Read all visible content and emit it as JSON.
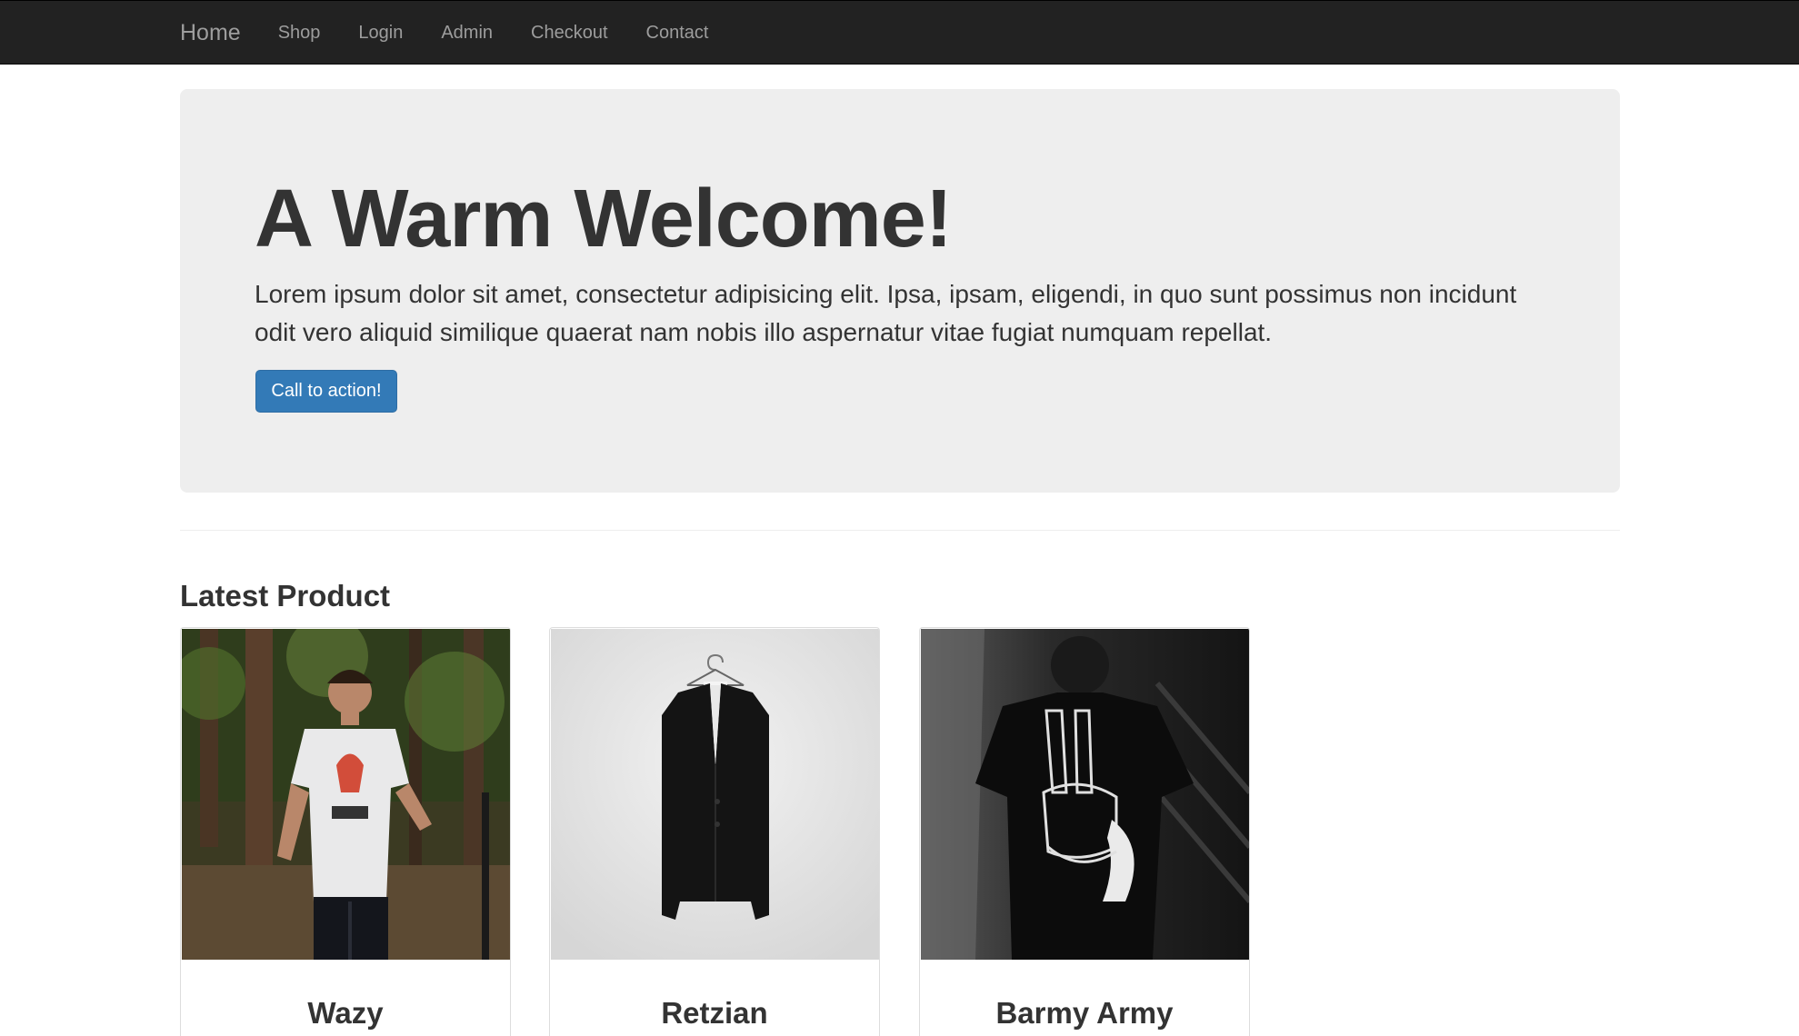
{
  "navbar": {
    "brand": "Home",
    "links": [
      "Shop",
      "Login",
      "Admin",
      "Checkout",
      "Contact"
    ]
  },
  "hero": {
    "title": "A Warm Welcome!",
    "text": "Lorem ipsum dolor sit amet, consectetur adipisicing elit. Ipsa, ipsam, eligendi, in quo sunt possimus non incidunt odit vero aliquid similique quaerat nam nobis illo aspernatur vitae fugiat numquam repellat.",
    "cta_label": "Call to action!"
  },
  "latest": {
    "heading": "Latest Product",
    "products": [
      {
        "name": "Wazy"
      },
      {
        "name": "Retzian"
      },
      {
        "name": "Barmy Army"
      }
    ]
  },
  "colors": {
    "navbar_bg": "#222222",
    "nav_text": "#9d9d9d",
    "jumbotron_bg": "#eeeeee",
    "primary": "#337ab7"
  }
}
